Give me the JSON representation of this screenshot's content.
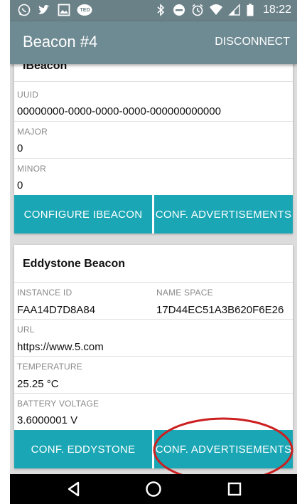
{
  "status_bar": {
    "time": "18:22",
    "left_icons": [
      "whatsapp-icon",
      "twitter-icon",
      "image-icon",
      "ted-icon"
    ],
    "ted_label": "TED",
    "right_icons": [
      "bluetooth-icon",
      "do-not-disturb-icon",
      "alarm-icon",
      "wifi-icon",
      "signal-icon",
      "battery-icon"
    ]
  },
  "app_bar": {
    "title": "Beacon #4",
    "action": "DISCONNECT",
    "color": "#6e8a92"
  },
  "ibeacon": {
    "title": "IBeacon",
    "uuid_label": "UUID",
    "uuid_value": "00000000-0000-0000-0000-000000000000",
    "major_label": "MAJOR",
    "major_value": "0",
    "minor_label": "MINOR",
    "minor_value": "0",
    "configure_button": "CONFIGURE IBEACON",
    "advertisements_button": "CONF. ADVERTISEMENTS"
  },
  "eddystone": {
    "title": "Eddystone Beacon",
    "instance_id_label": "INSTANCE ID",
    "instance_id_value": "FAA14D7D8A84",
    "name_space_label": "NAME SPACE",
    "name_space_value": "17D44EC51A3B620F6E26",
    "url_label": "URL",
    "url_value": "https://www.5.com",
    "temperature_label": "TEMPERATURE",
    "temperature_value": "25.25 °C",
    "battery_label": "BATTERY VOLTAGE",
    "battery_value": "3.6000001 V",
    "configure_button": "CONF. EDDYSTONE",
    "advertisements_button": "CONF. ADVERTISEMENTS"
  },
  "nav_bar": {
    "icons": [
      "back-icon",
      "home-icon",
      "recents-icon"
    ]
  },
  "colors": {
    "accent": "#1aa6b5",
    "annotation": "#cc1f1f"
  }
}
